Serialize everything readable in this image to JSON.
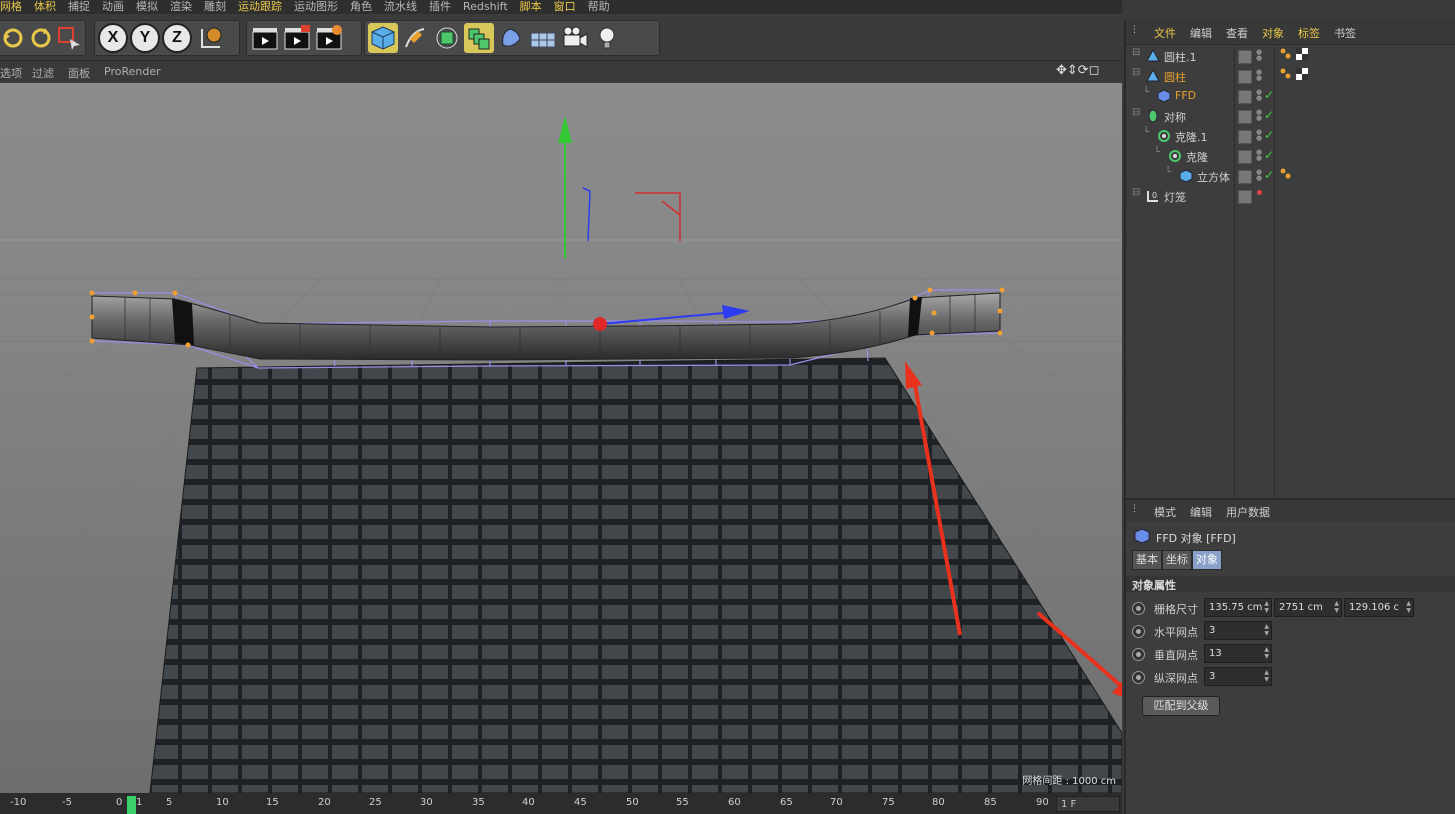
{
  "menu": [
    "网格",
    "体积",
    "捕捉",
    "动画",
    "模拟",
    "渲染",
    "雕刻",
    "运动跟踪",
    "运动图形",
    "角色",
    "流水线",
    "插件",
    "Redshift",
    "脚本",
    "窗口",
    "帮助"
  ],
  "menu_highlight": [
    0,
    1,
    7,
    13,
    14
  ],
  "viewport_menu": [
    "选项",
    "过滤",
    "面板",
    "ProRender"
  ],
  "grid_spacing": "网格间距 : 1000 cm",
  "timeline": {
    "ticks": [
      "-10",
      "-5",
      "0",
      "1",
      "5",
      "10",
      "15",
      "20",
      "25",
      "30",
      "35",
      "40",
      "45",
      "50",
      "55",
      "60",
      "65",
      "70",
      "75",
      "80",
      "85",
      "90"
    ],
    "frame_field": "1 F"
  },
  "object_manager": {
    "menu": [
      "文件",
      "编辑",
      "查看",
      "对象",
      "标签",
      "书签"
    ],
    "objects": [
      {
        "name": "圆柱.1",
        "indent": 0,
        "icon": "cylinder-icon",
        "selected": false,
        "check": false,
        "tags": true
      },
      {
        "name": "圆柱",
        "indent": 0,
        "icon": "cylinder-icon",
        "selected": true,
        "check": false,
        "tags": true
      },
      {
        "name": "FFD",
        "indent": 1,
        "icon": "ffd-icon",
        "selected": true,
        "check": true,
        "tags": false
      },
      {
        "name": "对称",
        "indent": 0,
        "icon": "symmetry-icon",
        "selected": false,
        "check": true,
        "tags": false
      },
      {
        "name": "克隆.1",
        "indent": 1,
        "icon": "cloner-icon",
        "selected": false,
        "check": true,
        "tags": false
      },
      {
        "name": "克隆",
        "indent": 2,
        "icon": "cloner-icon",
        "selected": false,
        "check": true,
        "tags": false
      },
      {
        "name": "立方体",
        "indent": 3,
        "icon": "cube-icon",
        "selected": false,
        "check": true,
        "tags": true
      },
      {
        "name": "灯笼",
        "indent": 0,
        "icon": "null-icon",
        "selected": false,
        "check": false,
        "tags": false,
        "red": true
      }
    ]
  },
  "attributes": {
    "menu": [
      "模式",
      "编辑",
      "用户数据"
    ],
    "title": "FFD 对象 [FFD]",
    "tabs": [
      "基本",
      "坐标",
      "对象"
    ],
    "active_tab": 2,
    "section": "对象属性",
    "grid_size_label": "栅格尺寸",
    "grid_size": [
      "135.75 cm",
      "2751 cm",
      "129.106 c"
    ],
    "h_label": "水平网点",
    "h_value": "3",
    "v_label": "垂直网点",
    "v_value": "13",
    "d_label": "纵深网点",
    "d_value": "3",
    "match_button": "匹配到父级"
  },
  "colors": {
    "accent": "#e8c84a",
    "selected_object": "#e8a030",
    "arrow": "#e8321e",
    "y_axis": "#34c834",
    "x_axis": "#2c3cf0"
  }
}
